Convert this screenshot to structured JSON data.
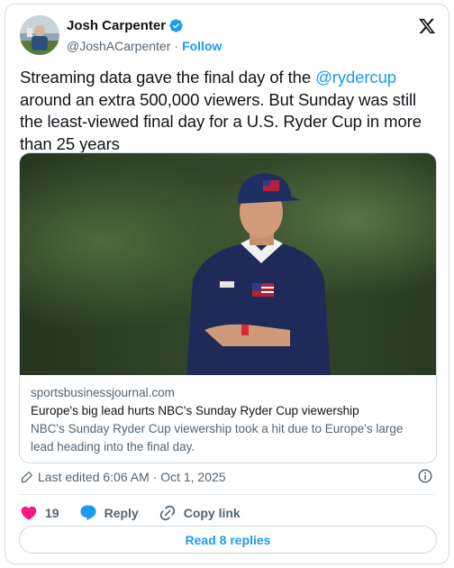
{
  "author": {
    "name": "Josh Carpenter",
    "handle": "@JoshACarpenter",
    "separator": "·",
    "follow_label": "Follow"
  },
  "tweet": {
    "text_before": "Streaming data gave the final day of the ",
    "mention": "@rydercup",
    "text_after": " around an extra 500,000 viewers. But Sunday was still the least-viewed final day for a U.S. Ryder Cup in more than 25 years"
  },
  "link_card": {
    "domain": "sportsbusinessjournal.com",
    "title": "Europe's big lead hurts NBC's Sunday Ryder Cup viewership",
    "description": "NBC's Sunday Ryder Cup viewership took a hit due to Europe's large lead heading into the final day."
  },
  "meta": {
    "edited": "Last edited 6:06 AM · Oct 1, 2025"
  },
  "actions": {
    "likes": "19",
    "reply_label": "Reply",
    "copy_link_label": "Copy link"
  },
  "read_replies_label": "Read 8 replies",
  "colors": {
    "accent": "#1d9bf0",
    "like": "#f91880",
    "text": "#0f1419",
    "secondary": "#536471"
  },
  "icons": [
    "verified-icon",
    "x-logo-icon",
    "pencil-icon",
    "info-icon",
    "heart-icon",
    "reply-bubble-icon",
    "link-icon"
  ]
}
